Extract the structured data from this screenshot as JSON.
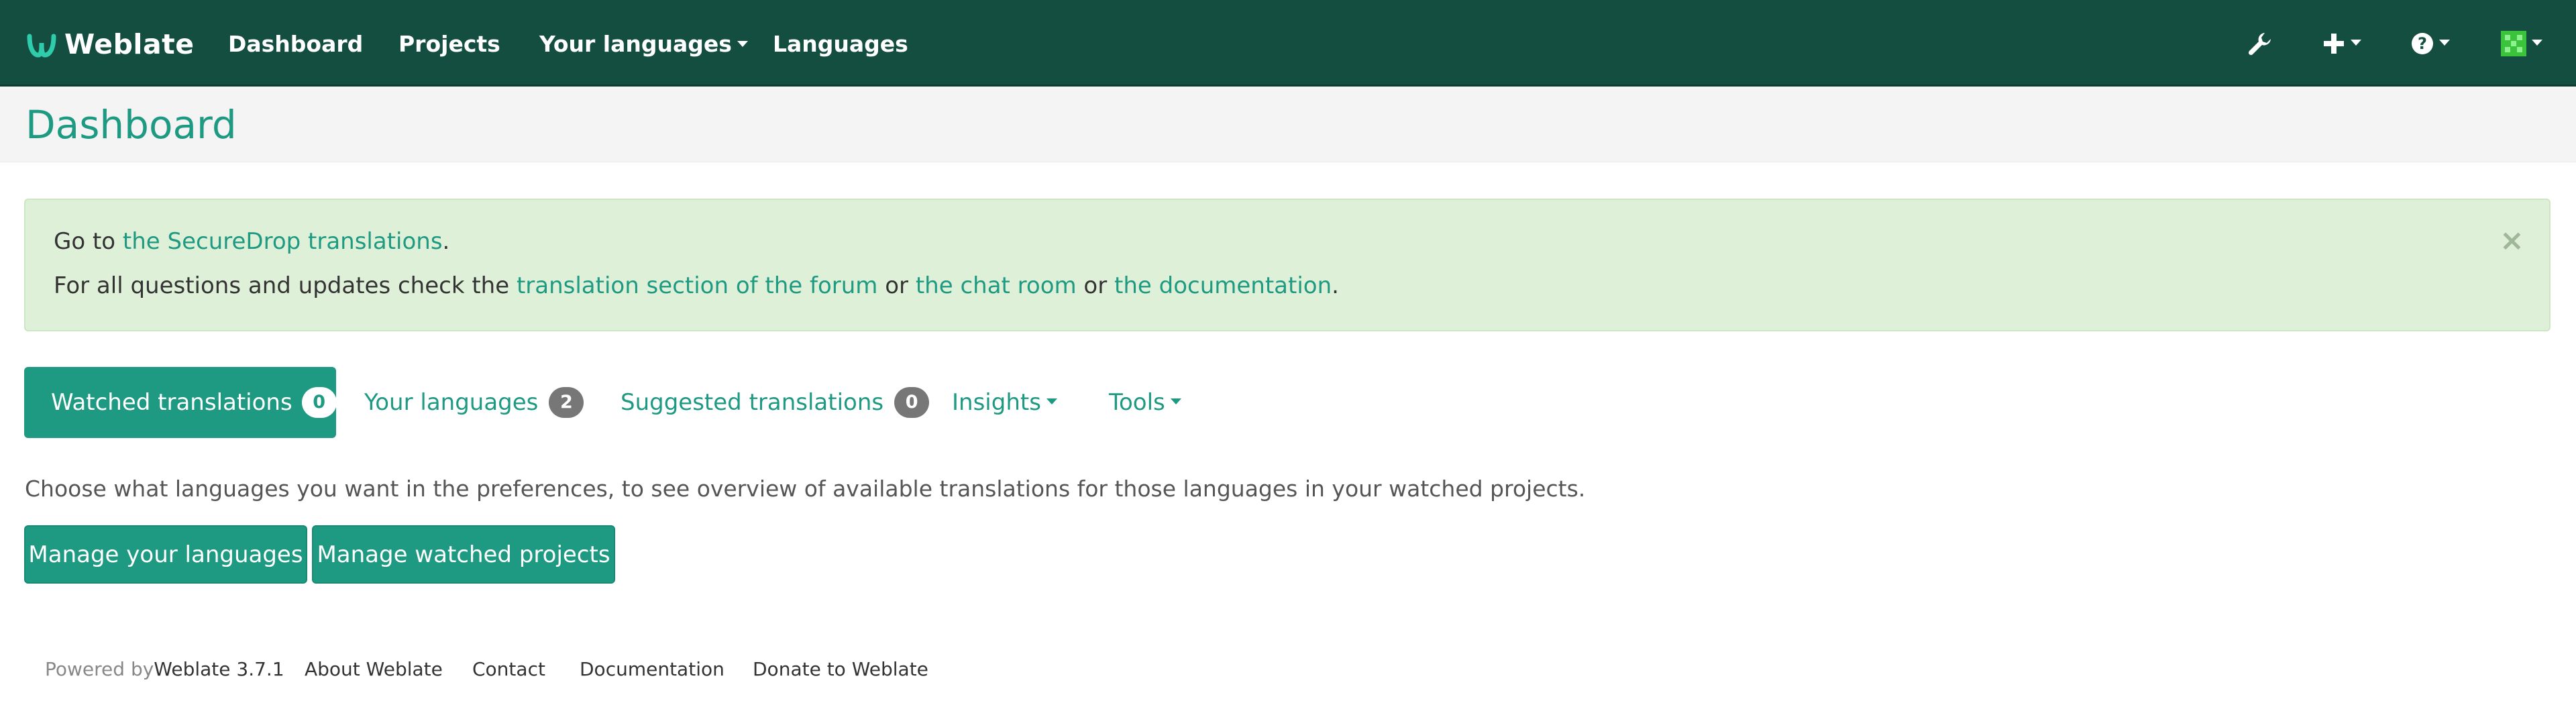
{
  "navbar": {
    "brand": "Weblate",
    "links": [
      "Dashboard",
      "Projects",
      "Your languages",
      "Languages"
    ],
    "icons": [
      "wrench-icon",
      "plus-icon",
      "help-icon",
      "avatar-icon"
    ],
    "colors": {
      "background": "#134e41",
      "accent": "#1e9a82"
    }
  },
  "header": {
    "title": "Dashboard"
  },
  "alert": {
    "line1_prefix": "Go to ",
    "line1_link": "the SecureDrop translations",
    "line1_suffix": ".",
    "line2_prefix": "For all questions and updates check the ",
    "line2_link1": "translation section of the forum",
    "line2_or1": " or ",
    "line2_link2": "the chat room",
    "line2_or2": " or ",
    "line2_link3": "the documentation",
    "line2_suffix": ".",
    "close": "×"
  },
  "tabs": {
    "watched": {
      "label": "Watched translations",
      "count": "0"
    },
    "your_languages": {
      "label": "Your languages",
      "count": "2"
    },
    "suggested": {
      "label": "Suggested translations",
      "count": "0"
    },
    "insights": {
      "label": "Insights"
    },
    "tools": {
      "label": "Tools"
    }
  },
  "main": {
    "info": "Choose what languages you want in the preferences, to see overview of available translations for those languages in your watched projects.",
    "manage_languages": "Manage your languages",
    "manage_projects": "Manage watched projects"
  },
  "footer": {
    "powered_by": "Powered by ",
    "version": "Weblate 3.7.1",
    "about": "About Weblate",
    "contact": "Contact",
    "documentation": "Documentation",
    "donate": "Donate to Weblate"
  }
}
